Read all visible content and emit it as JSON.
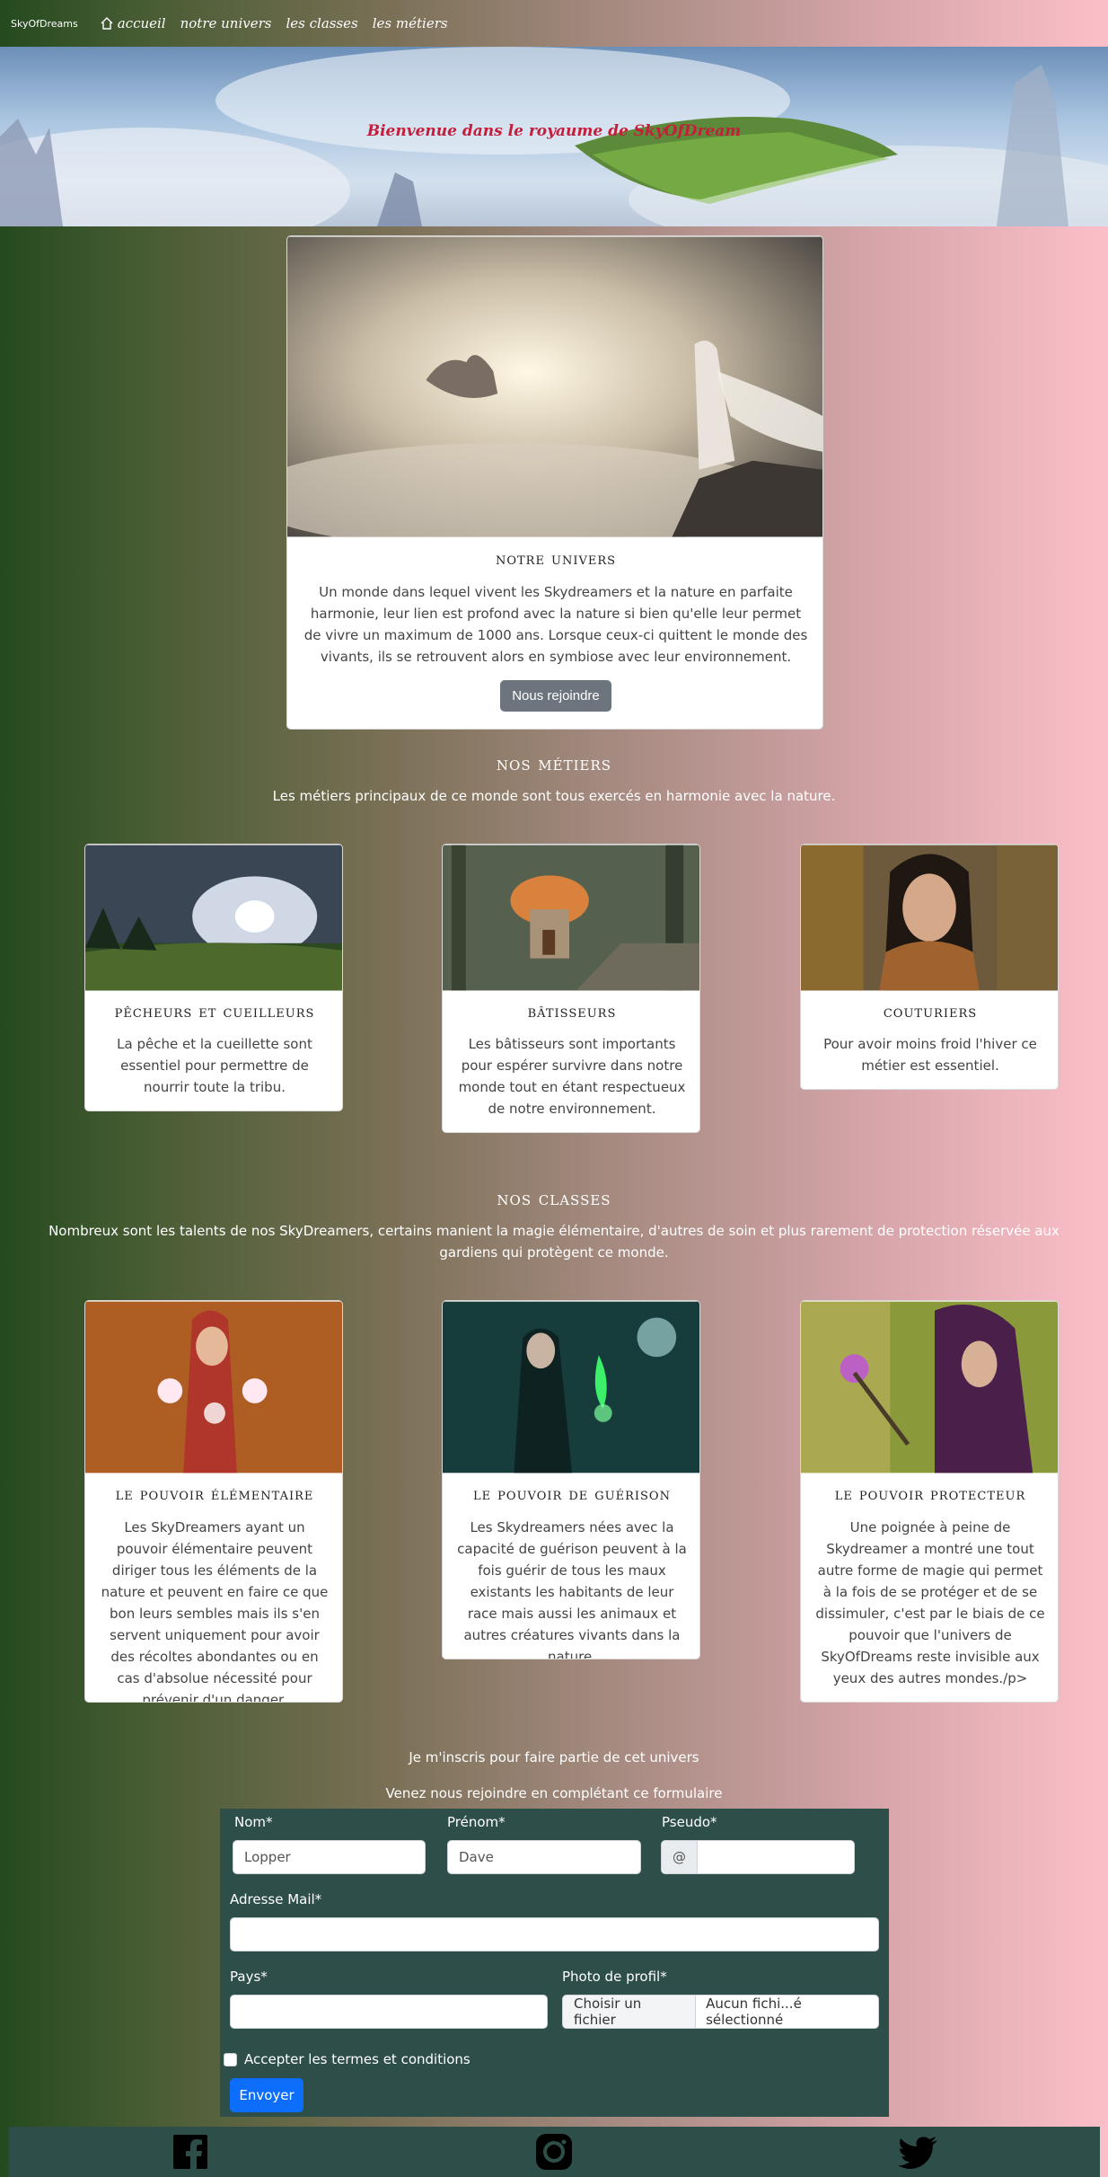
{
  "nav": {
    "brand": "SkyOfDreams",
    "links": [
      "accueil",
      "notre univers",
      "les classes",
      "les métiers"
    ]
  },
  "hero": {
    "title": "Bienvenue dans le royaume de SkyOfDream"
  },
  "univers": {
    "title": "notre univers",
    "text": "Un monde dans lequel vivent les Skydreamers et la nature en parfaite harmonie, leur lien est profond avec la nature si bien qu'elle leur permet de vivre un maximum de 1000 ans. Lorsque ceux-ci quittent le monde des vivants, ils se retrouvent alors en symbiose avec leur environnement.",
    "button": "Nous rejoindre"
  },
  "metiers": {
    "title": "nos métiers",
    "intro": "Les métiers principaux de ce monde sont tous exercés en harmonie avec la nature.",
    "cards": [
      {
        "title": "pêcheurs et cueilleurs",
        "text": "La pêche et la cueillette sont essentiel pour permettre de nourrir toute la tribu."
      },
      {
        "title": "bâtisseurs",
        "text": "Les bâtisseurs sont importants pour espérer survivre dans notre monde tout en étant respectueux de notre environnement."
      },
      {
        "title": "couturiers",
        "text": "Pour avoir moins froid l'hiver ce métier est essentiel."
      }
    ]
  },
  "classes": {
    "title": "nos classes",
    "intro": "Nombreux sont les talents de nos SkyDreamers, certains manient la magie élémentaire, d'autres de soin et plus rarement de protection réservée aux gardiens qui protègent ce monde.",
    "cards": [
      {
        "title": "le pouvoir élémentaire",
        "text": "Les SkyDreamers ayant un pouvoir élémentaire peuvent diriger tous les éléments de la nature et peuvent en faire ce que bon leurs sembles mais ils s'en servent uniquement pour avoir des récoltes abondantes ou en cas d'absolue nécessité pour prévenir d'un danger."
      },
      {
        "title": "le pouvoir de guérison",
        "text": "Les Skydreamers nées avec la capacité de guérison peuvent à la fois guérir de tous les maux existants les habitants de leur race mais aussi les animaux et autres créatures vivants dans la nature."
      },
      {
        "title": "le pouvoir protecteur",
        "text": "Une poignée à peine de Skydreamer a montré une tout autre forme de magie qui permet à la fois de se protéger et de se dissimuler, c'est par le biais de ce pouvoir que l'univers de SkyOfDreams reste invisible aux yeux des autres mondes./p>"
      }
    ]
  },
  "inscription": {
    "line1": "Je m'inscris pour faire partie de cet univers",
    "line2": "Venez nous rejoindre en complétant ce formulaire",
    "nom_label": "Nom*",
    "nom_value": "Lopper",
    "prenom_label": "Prénom*",
    "prenom_value": "Dave",
    "pseudo_label": "Pseudo*",
    "pseudo_prefix": "@",
    "mail_label": "Adresse Mail*",
    "pays_label": "Pays*",
    "photo_label": "Photo de profil*",
    "file_button": "Choisir un fichier",
    "file_status": "Aucun fichi...é sélectionné",
    "terms": "Accepter les termes et conditions",
    "submit": "Envoyer"
  },
  "footer": {
    "icons": [
      "facebook-icon",
      "instagram-icon",
      "twitter-icon"
    ]
  }
}
